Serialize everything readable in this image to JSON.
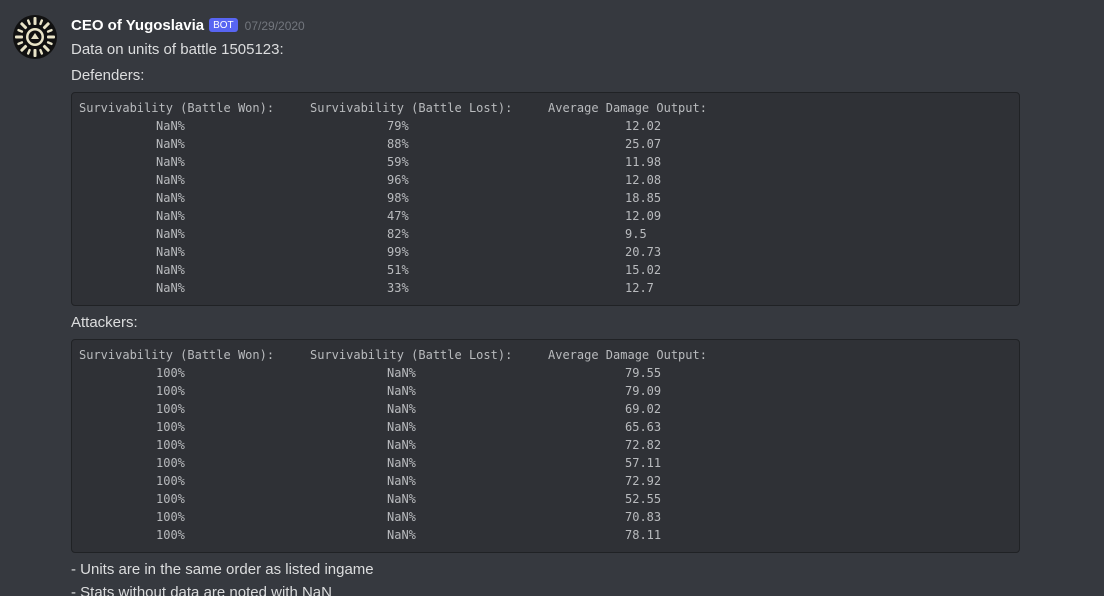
{
  "message": {
    "author": "CEO of Yugoslavia",
    "bot_tag": "BOT",
    "timestamp": "07/29/2020",
    "intro": "Data on units of battle 1505123:",
    "defenders_label": "Defenders:",
    "attackers_label": "Attackers:",
    "note_1": "- Units are in the same order as listed ingame",
    "note_2": "- Stats without data are noted with NaN"
  },
  "table_headers": {
    "won": "Survivability (Battle Won):",
    "lost": "Survivability (Battle Lost):",
    "damage": "Average Damage Output:"
  },
  "defenders": [
    {
      "won": "NaN%",
      "lost": "79%",
      "damage": "12.02"
    },
    {
      "won": "NaN%",
      "lost": "88%",
      "damage": "25.07"
    },
    {
      "won": "NaN%",
      "lost": "59%",
      "damage": "11.98"
    },
    {
      "won": "NaN%",
      "lost": "96%",
      "damage": "12.08"
    },
    {
      "won": "NaN%",
      "lost": "98%",
      "damage": "18.85"
    },
    {
      "won": "NaN%",
      "lost": "47%",
      "damage": "12.09"
    },
    {
      "won": "NaN%",
      "lost": "82%",
      "damage": "9.5"
    },
    {
      "won": "NaN%",
      "lost": "99%",
      "damage": "20.73"
    },
    {
      "won": "NaN%",
      "lost": "51%",
      "damage": "15.02"
    },
    {
      "won": "NaN%",
      "lost": "33%",
      "damage": "12.7"
    }
  ],
  "attackers": [
    {
      "won": "100%",
      "lost": "NaN%",
      "damage": "79.55"
    },
    {
      "won": "100%",
      "lost": "NaN%",
      "damage": "79.09"
    },
    {
      "won": "100%",
      "lost": "NaN%",
      "damage": "69.02"
    },
    {
      "won": "100%",
      "lost": "NaN%",
      "damage": "65.63"
    },
    {
      "won": "100%",
      "lost": "NaN%",
      "damage": "72.82"
    },
    {
      "won": "100%",
      "lost": "NaN%",
      "damage": "57.11"
    },
    {
      "won": "100%",
      "lost": "NaN%",
      "damage": "72.92"
    },
    {
      "won": "100%",
      "lost": "NaN%",
      "damage": "52.55"
    },
    {
      "won": "100%",
      "lost": "NaN%",
      "damage": "70.83"
    },
    {
      "won": "100%",
      "lost": "NaN%",
      "damage": "78.11"
    }
  ],
  "colors": {
    "background": "#36393f",
    "codeblock": "#2f3136",
    "bot_tag": "#5865f2",
    "username": "#ffffff",
    "text": "#dcddde",
    "timestamp": "#72767d"
  },
  "icons": {
    "avatar": "sunburst-avatar-icon"
  }
}
